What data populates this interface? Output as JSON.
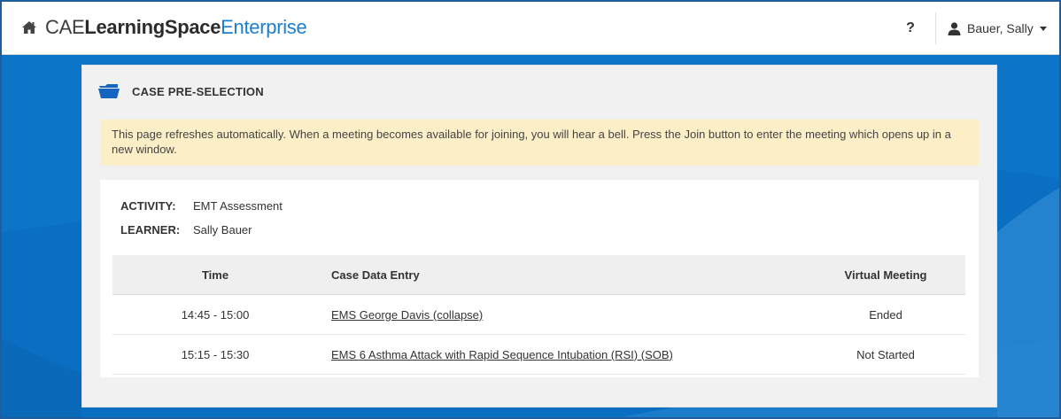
{
  "header": {
    "brand_part1": "CAE",
    "brand_part2": "LearningSpace",
    "brand_part3": "Enterprise",
    "help_label": "?",
    "user_name": "Bauer, Sally"
  },
  "panel": {
    "title": "CASE PRE-SELECTION",
    "alert_text": "This page refreshes automatically. When a meeting becomes available for joining, you will hear a bell. Press the Join button to enter the meeting which opens up in a new window."
  },
  "info": {
    "activity_label": "ACTIVITY:",
    "activity_value": "EMT Assessment",
    "learner_label": "LEARNER:",
    "learner_value": "Sally Bauer"
  },
  "table": {
    "headers": [
      "Time",
      "Case Data Entry",
      "Virtual Meeting"
    ],
    "rows": [
      {
        "time": "14:45 - 15:00",
        "case": "EMS George Davis (collapse)",
        "status": "Ended"
      },
      {
        "time": "15:15 - 15:30",
        "case": "EMS 6 Asthma Attack with Rapid Sequence Intubation (RSI) (SOB)",
        "status": "Not Started"
      }
    ]
  },
  "icons": {
    "home": "home-icon",
    "user": "user-icon",
    "caret": "chevron-down-icon",
    "folder": "folder-open-icon"
  },
  "colors": {
    "brand_blue": "#1a7fd0",
    "background_blue": "#0a6fc2",
    "alert_bg": "#fcefc7",
    "folder_blue": "#1565c0"
  }
}
